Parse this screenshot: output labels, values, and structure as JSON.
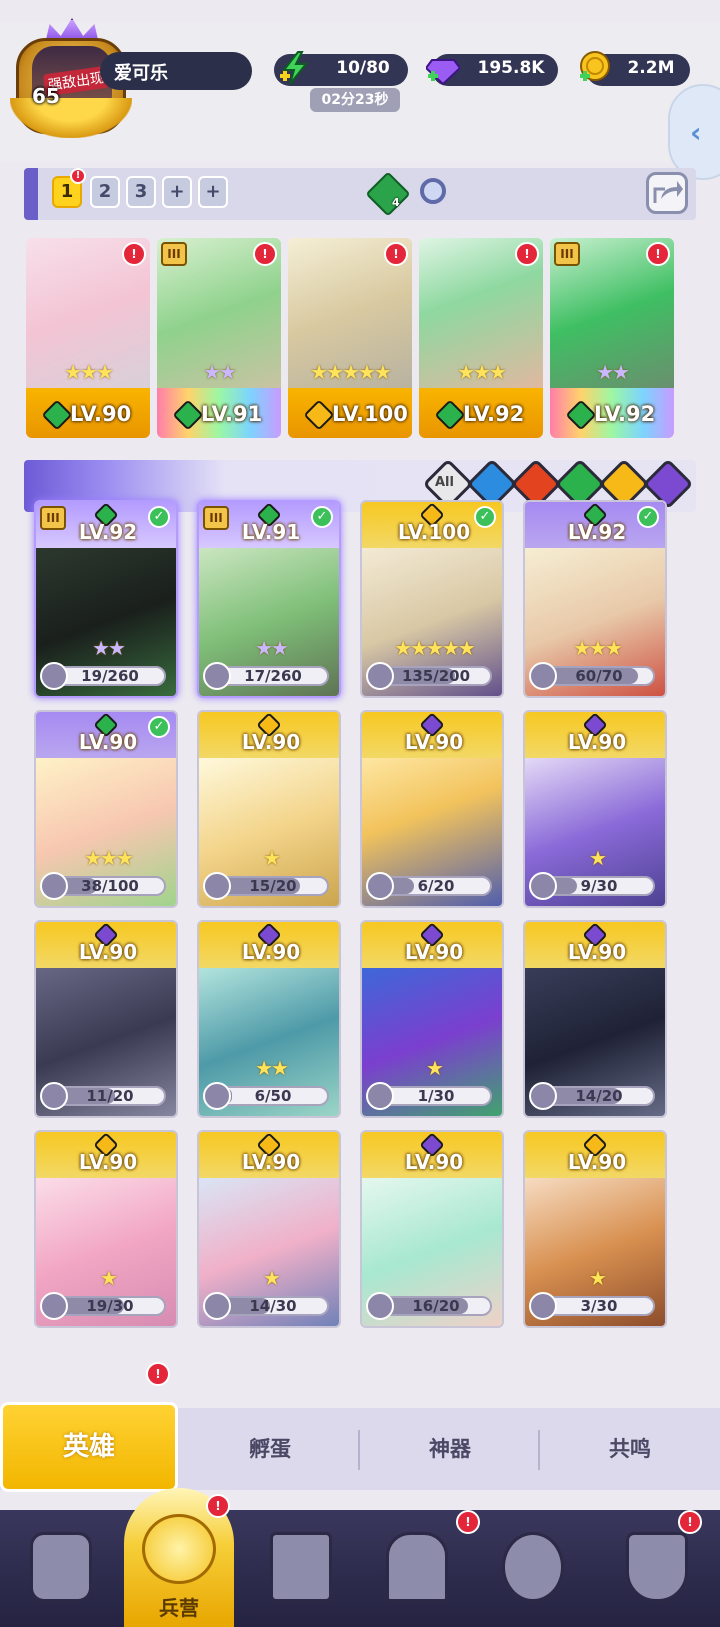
{
  "header": {
    "player_level": "65",
    "avatar_badge": "强敌出现",
    "player_name": "爱可乐",
    "energy": "10/80",
    "energy_timer": "02分23秒",
    "gems": "195.8K",
    "gold": "2.2M"
  },
  "team_bar": {
    "slots": [
      "1",
      "2",
      "3",
      "+",
      "+"
    ],
    "active_slot": "1",
    "gem_count": "4"
  },
  "team": [
    {
      "element": "wind",
      "level": "LV.90",
      "stars": "★★★",
      "star_color": "gold",
      "alert": "!",
      "tier": ""
    },
    {
      "element": "wind",
      "level": "LV.91",
      "stars": "★★",
      "star_color": "purple",
      "alert": "!",
      "tier": "III"
    },
    {
      "element": "light",
      "level": "LV.100",
      "stars": "★★★★★",
      "star_color": "gold",
      "alert": "!",
      "tier": ""
    },
    {
      "element": "wind",
      "level": "LV.92",
      "stars": "★★★",
      "star_color": "gold",
      "alert": "!",
      "tier": ""
    },
    {
      "element": "wind",
      "level": "LV.92",
      "stars": "★★",
      "star_color": "purple",
      "alert": "!",
      "tier": "III"
    }
  ],
  "filters": {
    "all_label": "All",
    "elements": [
      "water",
      "fire",
      "wind",
      "light",
      "dark"
    ]
  },
  "roster": [
    {
      "element": "wind",
      "level": "LV.92",
      "progress": "19/260",
      "fraction": 0.073,
      "tier": "III",
      "checked": true,
      "stars": "★★",
      "star_color": "purple",
      "selected": true
    },
    {
      "element": "wind",
      "level": "LV.91",
      "progress": "17/260",
      "fraction": 0.065,
      "tier": "III",
      "checked": true,
      "stars": "★★",
      "star_color": "purple",
      "selected": true
    },
    {
      "element": "light",
      "level": "LV.100",
      "progress": "135/200",
      "fraction": 0.675,
      "tier": "",
      "checked": true,
      "stars": "★★★★★",
      "star_color": "gold",
      "selected": false
    },
    {
      "element": "wind",
      "level": "LV.92",
      "progress": "60/70",
      "fraction": 0.857,
      "tier": "",
      "checked": true,
      "stars": "★★★",
      "star_color": "gold",
      "selected": false
    },
    {
      "element": "wind",
      "level": "LV.90",
      "progress": "38/100",
      "fraction": 0.38,
      "tier": "",
      "checked": true,
      "stars": "★★★",
      "star_color": "gold",
      "selected": false
    },
    {
      "element": "light",
      "level": "LV.90",
      "progress": "15/20",
      "fraction": 0.75,
      "tier": "",
      "checked": false,
      "stars": "★",
      "star_color": "gold",
      "selected": false
    },
    {
      "element": "dark",
      "level": "LV.90",
      "progress": "6/20",
      "fraction": 0.3,
      "tier": "",
      "checked": false,
      "stars": "",
      "star_color": "gold",
      "selected": false
    },
    {
      "element": "dark",
      "level": "LV.90",
      "progress": "9/30",
      "fraction": 0.3,
      "tier": "",
      "checked": false,
      "stars": "★",
      "star_color": "gold",
      "selected": false
    },
    {
      "element": "dark",
      "level": "LV.90",
      "progress": "11/20",
      "fraction": 0.55,
      "tier": "",
      "checked": false,
      "stars": "",
      "star_color": "gold",
      "selected": false
    },
    {
      "element": "dark",
      "level": "LV.90",
      "progress": "6/50",
      "fraction": 0.12,
      "tier": "",
      "checked": false,
      "stars": "★★",
      "star_color": "gold",
      "selected": false
    },
    {
      "element": "dark",
      "level": "LV.90",
      "progress": "1/30",
      "fraction": 0.033,
      "tier": "",
      "checked": false,
      "stars": "★",
      "star_color": "gold",
      "selected": false
    },
    {
      "element": "dark",
      "level": "LV.90",
      "progress": "14/20",
      "fraction": 0.7,
      "tier": "",
      "checked": false,
      "stars": "",
      "star_color": "gold",
      "selected": false
    },
    {
      "element": "light",
      "level": "LV.90",
      "progress": "19/30",
      "fraction": 0.633,
      "tier": "",
      "checked": false,
      "stars": "★",
      "star_color": "gold",
      "selected": false
    },
    {
      "element": "light",
      "level": "LV.90",
      "progress": "14/30",
      "fraction": 0.467,
      "tier": "",
      "checked": false,
      "stars": "★",
      "star_color": "gold",
      "selected": false
    },
    {
      "element": "dark",
      "level": "LV.90",
      "progress": "16/20",
      "fraction": 0.8,
      "tier": "",
      "checked": false,
      "stars": "",
      "star_color": "gold",
      "selected": false
    },
    {
      "element": "light",
      "level": "LV.90",
      "progress": "3/30",
      "fraction": 0.1,
      "tier": "",
      "checked": false,
      "stars": "★",
      "star_color": "gold",
      "selected": false
    }
  ],
  "sub_tabs": {
    "heroes": "英雄",
    "hatch": "孵蛋",
    "artifacts": "神器",
    "resonance": "共鸣",
    "heroes_alert": "!"
  },
  "bottom_nav": {
    "barracks_label": "兵营",
    "alert": "!"
  },
  "colors": {
    "accent_gold": "#f6b917",
    "alert_red": "#e4263a",
    "nav_bg": "#2f2d4e",
    "wind": "#2bb24c",
    "light": "#f6b917",
    "dark": "#7b4ad1",
    "water": "#2c8ce0",
    "fire": "#e4431f"
  }
}
